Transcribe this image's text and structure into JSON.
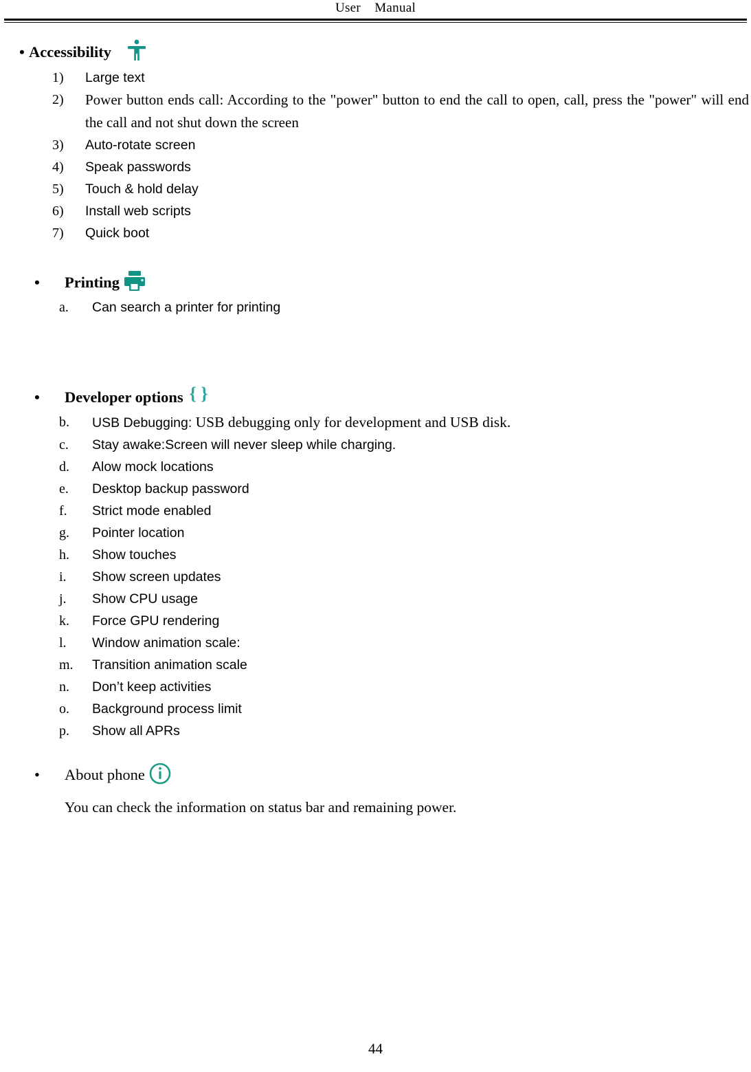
{
  "header": {
    "title": "User    Manual"
  },
  "page_number": "44",
  "sections": [
    {
      "id": "accessibility",
      "heading": "Accessibility",
      "icon": "accessibility-person-icon",
      "icon_color": "#17938a",
      "marker": "•",
      "list_type": "decimal-paren",
      "items": [
        {
          "marker": "1)",
          "text": "Large text"
        },
        {
          "marker": "2)",
          "text": "Power button ends call: According to the \"power\" button to end the call to open, call, press the \"power\" will end the call and not shut down the screen"
        },
        {
          "marker": "3)",
          "text": "Auto-rotate screen"
        },
        {
          "marker": "4)",
          "text": "Speak passwords"
        },
        {
          "marker": "5)",
          "text": "Touch & hold delay"
        },
        {
          "marker": "6)",
          "text": "Install web scripts"
        },
        {
          "marker": "7)",
          "text": "Quick boot"
        }
      ]
    },
    {
      "id": "printing",
      "heading": "Printing",
      "icon": "printer-icon",
      "icon_color": "#139383",
      "marker": "•",
      "list_type": "lower-alpha",
      "items": [
        {
          "marker": "a.",
          "text": "Can search a printer for printing"
        }
      ]
    },
    {
      "id": "developer-options",
      "heading": "Developer    options",
      "icon": "curly-braces-icon",
      "icon_color": "#2aa79b",
      "marker": "•",
      "list_type": "lower-alpha",
      "items": [
        {
          "marker": "b.",
          "text_sans": "USB Debugging:",
          "text_serif": " USB debugging only for development and USB disk."
        },
        {
          "marker": "c.",
          "text": "Stay awake:Screen will never sleep while charging."
        },
        {
          "marker": "d.",
          "text": "Alow mock locations"
        },
        {
          "marker": "e.",
          "text": "Desktop backup password"
        },
        {
          "marker": "f.",
          "text": "Strict mode enabled"
        },
        {
          "marker": "g.",
          "text": "Pointer location"
        },
        {
          "marker": "h.",
          "text": "Show touches"
        },
        {
          "marker": "i.",
          "text": "Show screen updates"
        },
        {
          "marker": "j.",
          "text": "Show   CPU usage"
        },
        {
          "marker": "k.",
          "text": "Force GPU rendering"
        },
        {
          "marker": "l.",
          "text": "Window animation scale:"
        },
        {
          "marker": "m.",
          "text": "Transition animation scale"
        },
        {
          "marker": "n.",
          "text": "Don’t keep activities"
        },
        {
          "marker": "o.",
          "text": "Background process limit"
        },
        {
          "marker": "p.",
          "text": "Show all APRs"
        }
      ]
    },
    {
      "id": "about-phone",
      "heading": "About phone",
      "icon": "info-circle-icon",
      "icon_color": "#1e9b84",
      "marker": "•",
      "paragraph": "You can check the information on status bar and remaining power."
    }
  ]
}
